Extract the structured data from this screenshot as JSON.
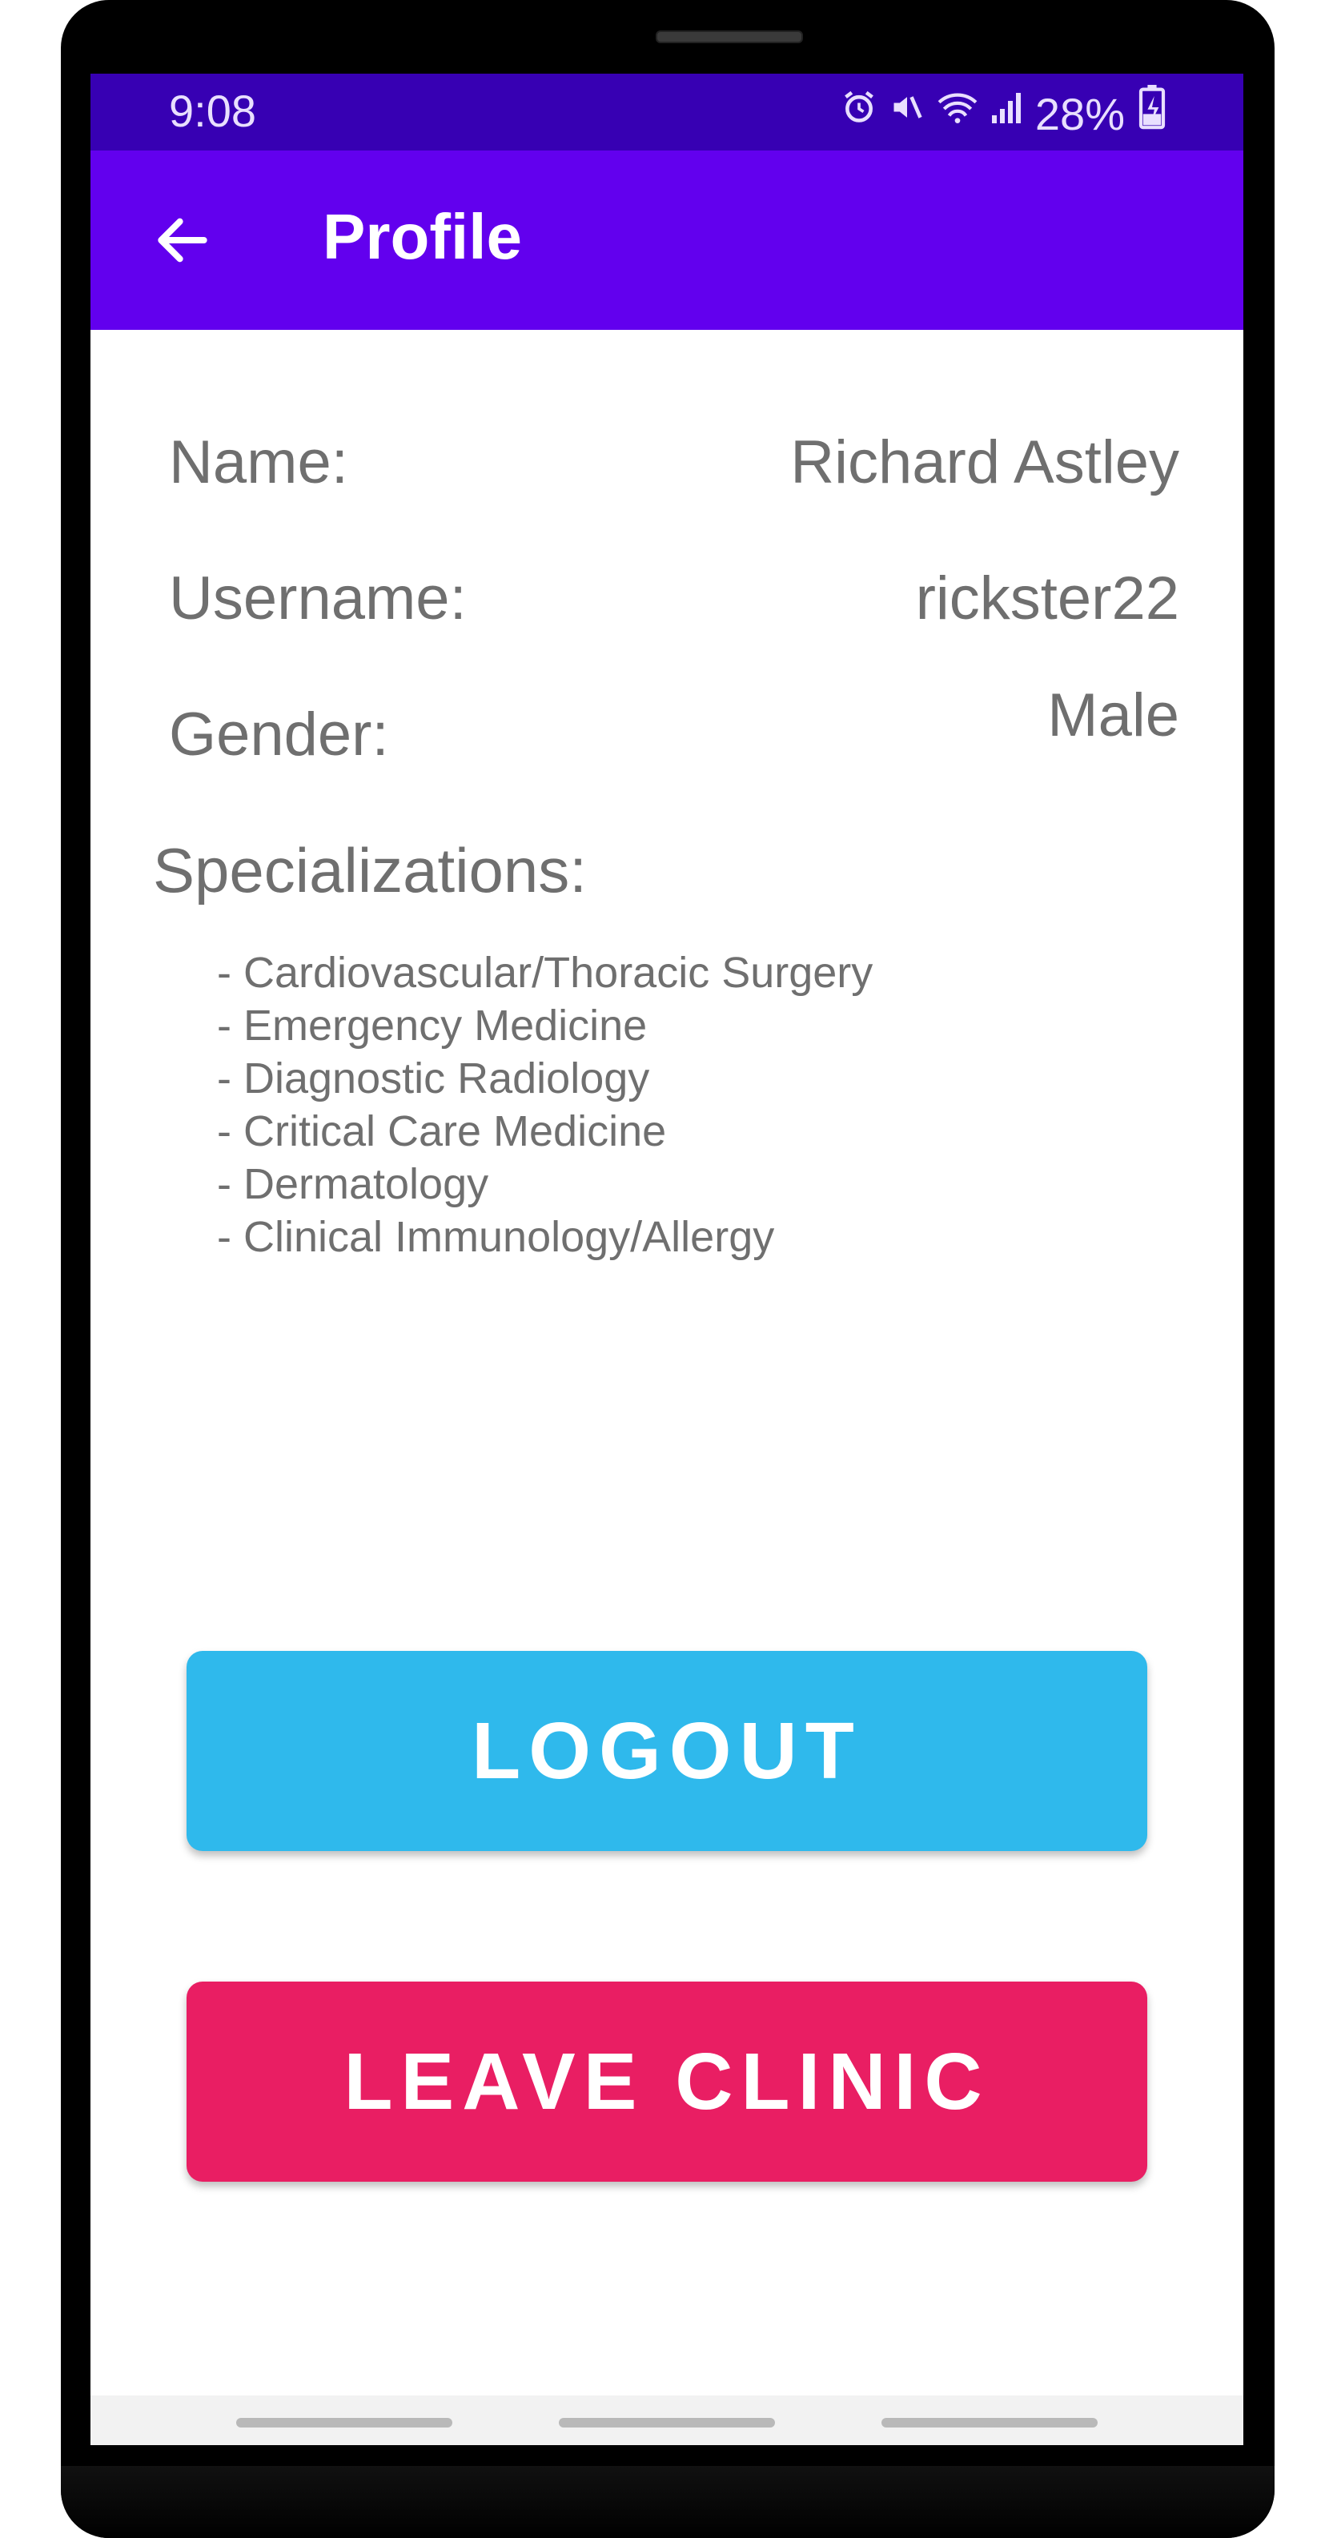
{
  "status_bar": {
    "time": "9:08",
    "battery_percent": "28%",
    "icons": [
      "alarm-icon",
      "mute-icon",
      "wifi-icon",
      "signal-icon",
      "battery-charging-icon"
    ]
  },
  "app_bar": {
    "title": "Profile",
    "back_icon": "arrow-left-icon",
    "color": "#6200ee"
  },
  "profile": {
    "name_label": "Name:",
    "name_value": "Richard Astley",
    "username_label": "Username:",
    "username_value": "rickster22",
    "gender_label": "Gender:",
    "gender_value": "Male"
  },
  "specializations": {
    "title": "Specializations:",
    "items": [
      "- Cardiovascular/Thoracic Surgery",
      "- Emergency Medicine",
      "- Diagnostic Radiology",
      "- Critical Care Medicine",
      "- Dermatology",
      "- Clinical Immunology/Allergy"
    ]
  },
  "buttons": {
    "logout_label": "LOGOUT",
    "logout_color": "#2fb9ec",
    "leave_label": "LEAVE CLINIC",
    "leave_color": "#e91e63"
  }
}
